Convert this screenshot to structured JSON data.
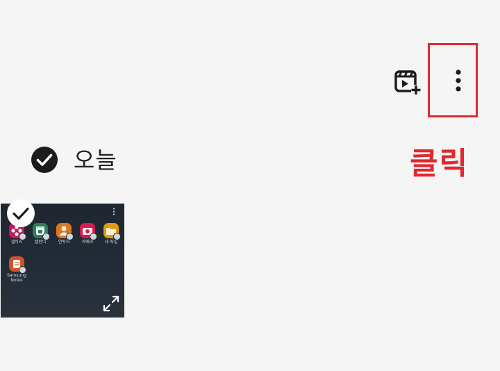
{
  "toolbar": {
    "movie_icon": "movie-add-icon",
    "more_icon": "more-vertical-icon"
  },
  "annotation": {
    "text": "클릭",
    "color": "#e0282e"
  },
  "date_group": {
    "label": "오늘",
    "selected": true
  },
  "thumbnail": {
    "selected": true,
    "apps": [
      {
        "label": "갤러리",
        "color": "#c2185b"
      },
      {
        "label": "캘린더",
        "color": "#2e7d5b"
      },
      {
        "label": "연락처",
        "color": "#e2761e"
      },
      {
        "label": "카메라",
        "color": "#d81b4f"
      },
      {
        "label": "내 파일",
        "color": "#e09a12"
      },
      {
        "label": "Samsung\nNotes",
        "color": "#d2522a"
      }
    ]
  }
}
